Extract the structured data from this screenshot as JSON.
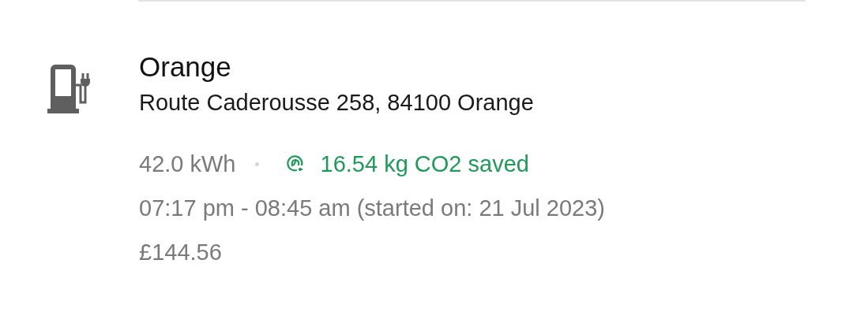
{
  "session": {
    "title": "Orange",
    "address": "Route Caderousse 258, 84100 Orange",
    "energy": "42.0 kWh",
    "co2": "16.54 kg CO2 saved",
    "time": "07:17 pm - 08:45 am (started on: 21 Jul 2023)",
    "price": "£144.56"
  }
}
